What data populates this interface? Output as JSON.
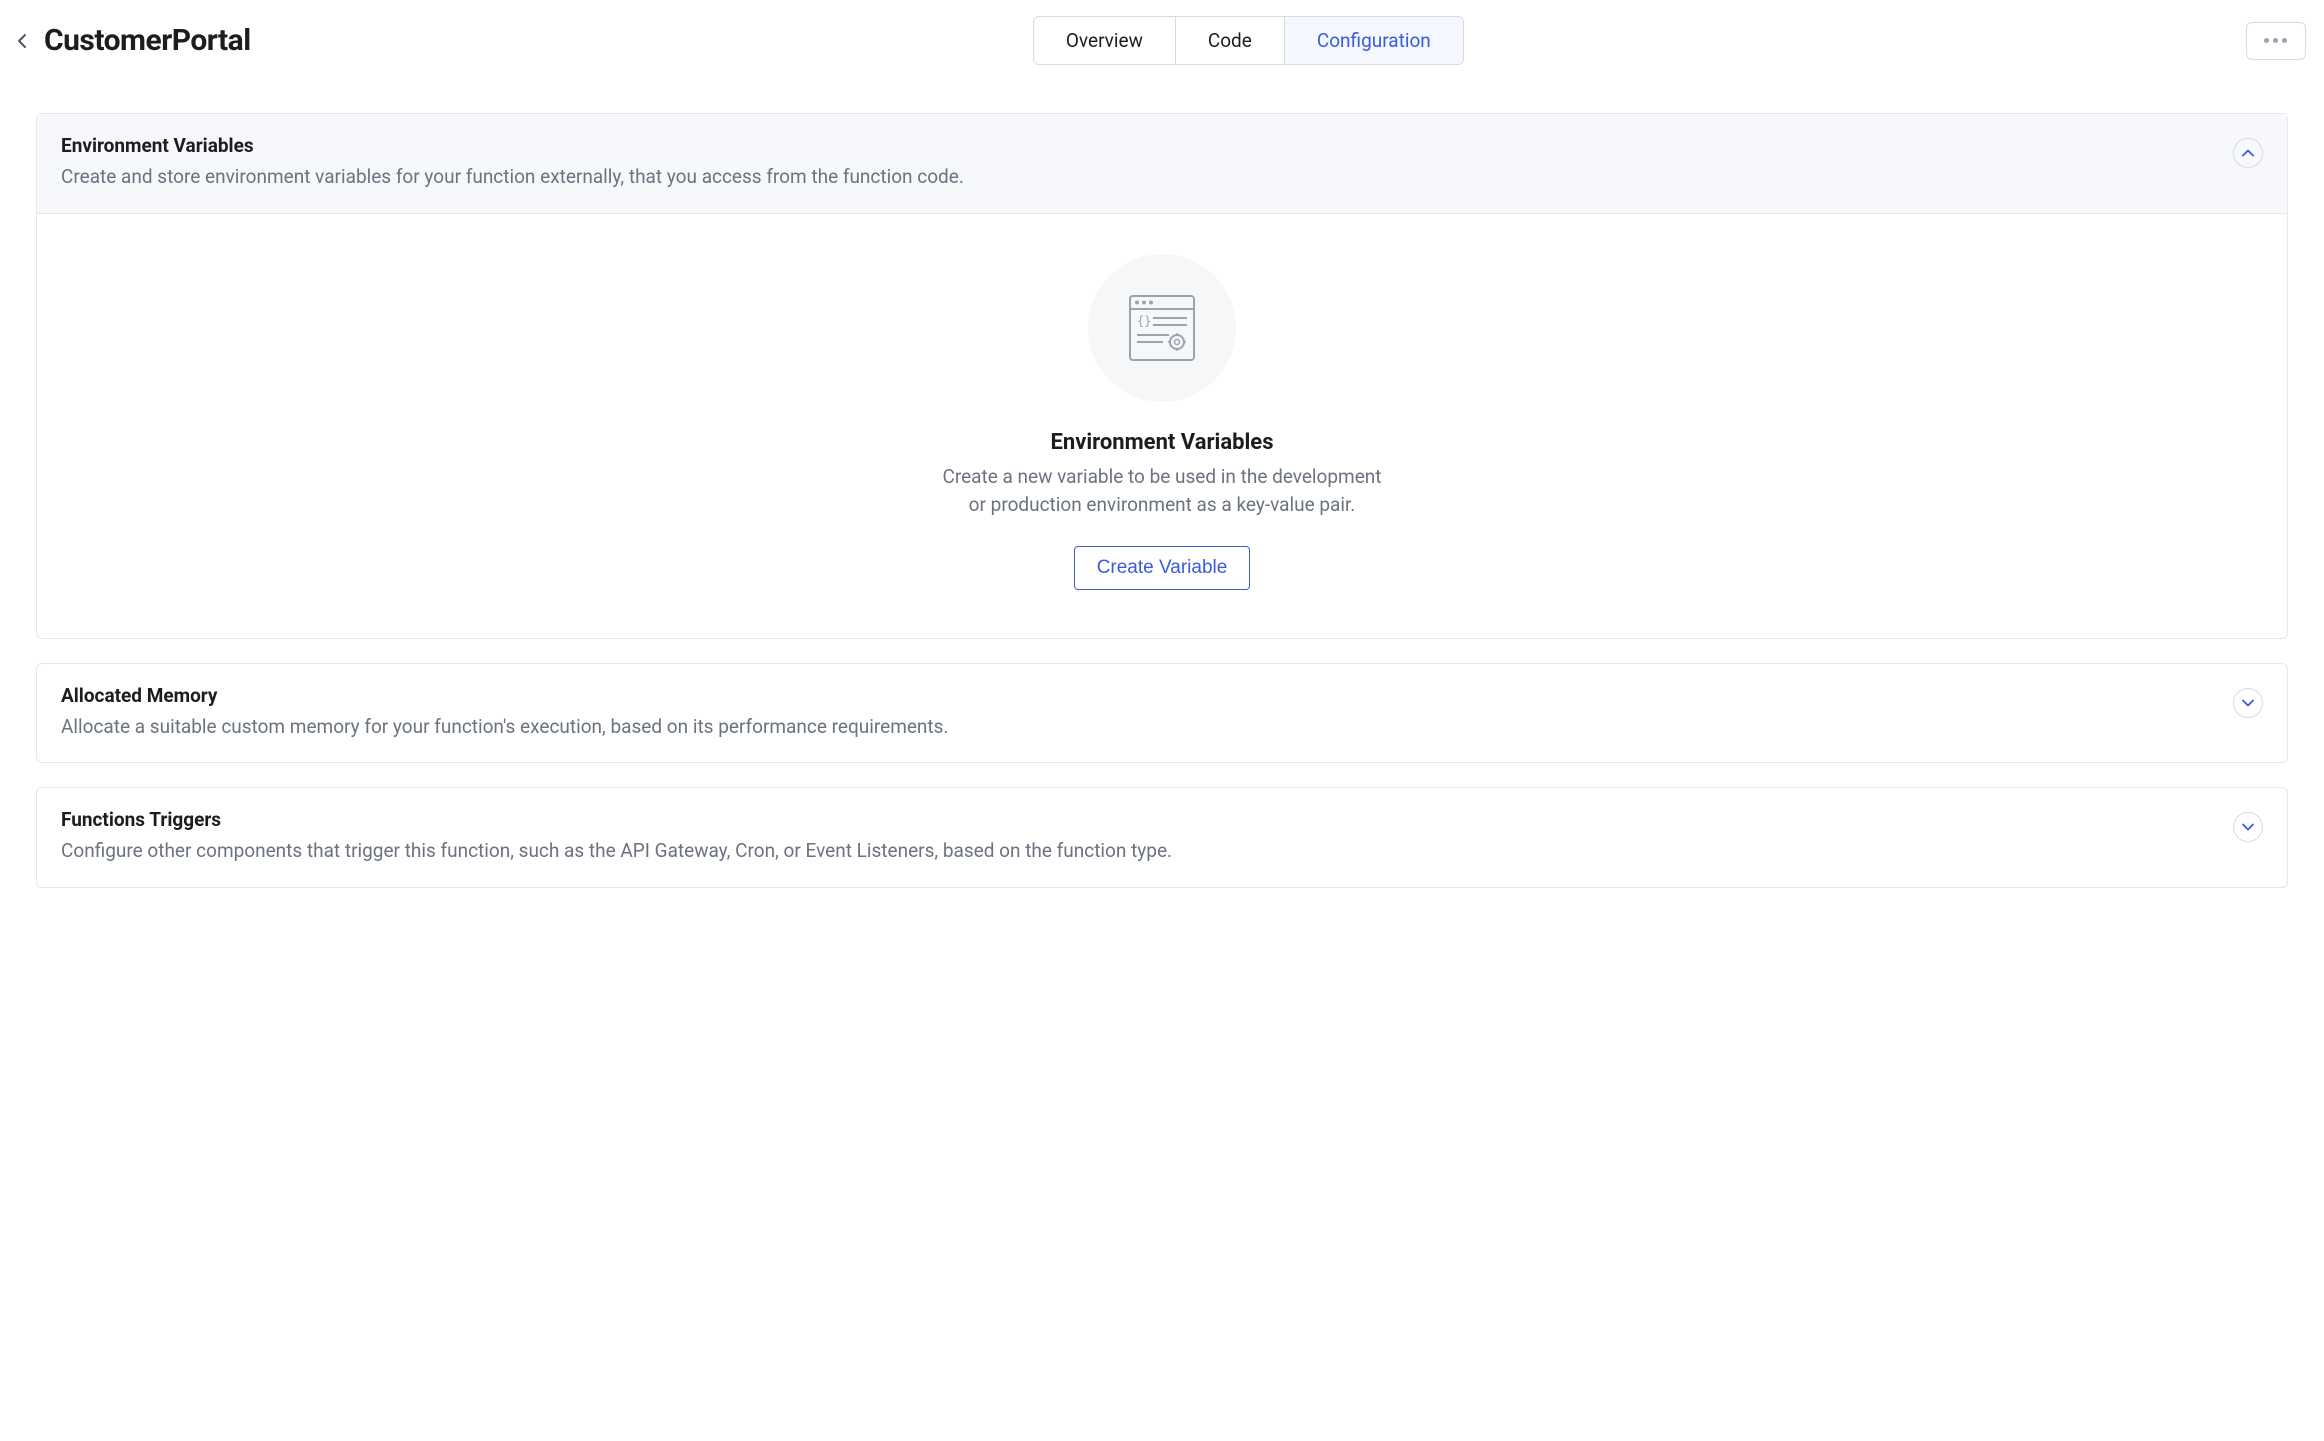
{
  "header": {
    "title": "CustomerPortal",
    "tabs": [
      {
        "label": "Overview",
        "active": false
      },
      {
        "label": "Code",
        "active": false
      },
      {
        "label": "Configuration",
        "active": true
      }
    ]
  },
  "panels": {
    "env": {
      "title": "Environment Variables",
      "desc": "Create and store environment variables for your function externally, that you access from the function code.",
      "expanded": true,
      "empty": {
        "title": "Environment Variables",
        "desc": "Create a new variable to be used in the development or production environment as a key-value pair.",
        "button": "Create Variable"
      }
    },
    "memory": {
      "title": "Allocated Memory",
      "desc": "Allocate a suitable custom memory for your function's execution, based on its performance requirements.",
      "expanded": false
    },
    "triggers": {
      "title": "Functions Triggers",
      "desc": "Configure other components that trigger this function, such as the API Gateway, Cron, or Event Listeners, based on the function type.",
      "expanded": false
    }
  },
  "colors": {
    "accent": "#3b5bdb"
  }
}
